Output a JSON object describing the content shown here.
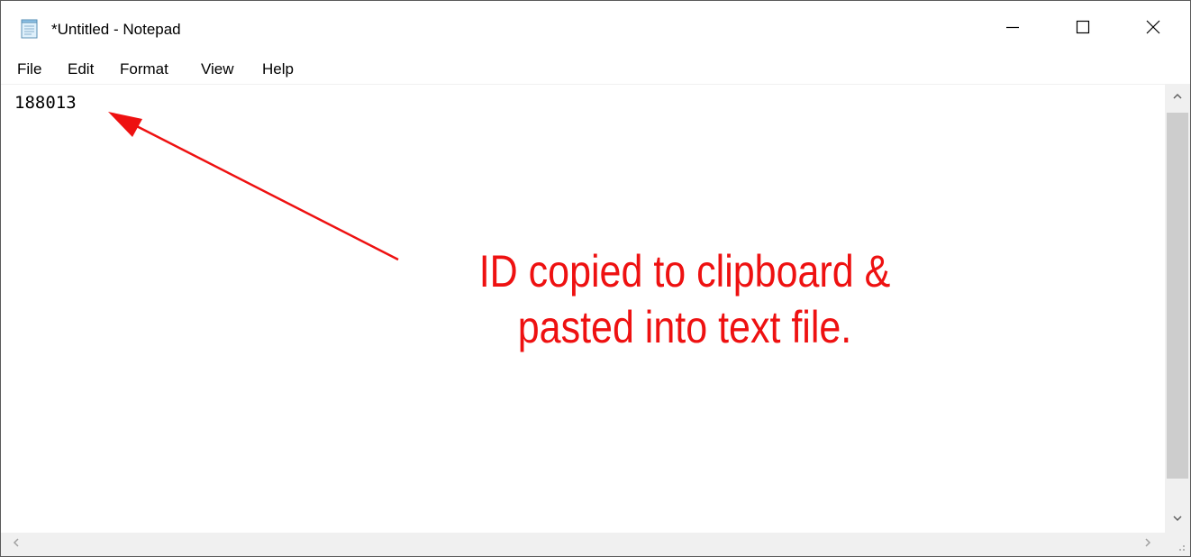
{
  "window": {
    "title": "*Untitled - Notepad",
    "app_icon": "notepad-icon",
    "controls": {
      "minimize_icon": "minimize-icon",
      "maximize_icon": "maximize-icon",
      "close_icon": "close-icon"
    }
  },
  "menu": {
    "items": [
      "File",
      "Edit",
      "Format",
      "View",
      "Help"
    ]
  },
  "editor": {
    "content": "188013"
  },
  "annotation": {
    "line1": "ID copied to clipboard &",
    "line2": "pasted into text file.",
    "color": "#ee1111"
  },
  "scrollbars": {
    "vertical": {
      "up_icon": "chevron-up-icon",
      "down_icon": "chevron-down-icon"
    },
    "horizontal": {
      "left_icon": "chevron-left-icon",
      "right_icon": "chevron-right-icon"
    }
  }
}
